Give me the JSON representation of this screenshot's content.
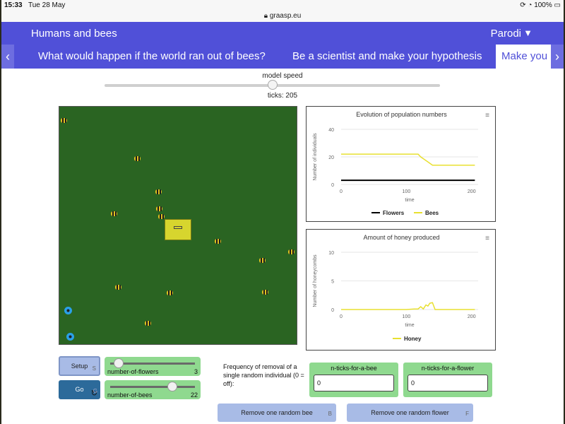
{
  "status": {
    "time": "15:33",
    "date": "Tue 28 May",
    "battery": "100%"
  },
  "browser": {
    "url": "graasp.eu"
  },
  "app": {
    "title": "Humans and bees",
    "user": "Parodi"
  },
  "tabs": [
    {
      "label": "What would happen if the world ran out of bees?"
    },
    {
      "label": "Be a scientist and make your hypothesis"
    },
    {
      "label": "Make you"
    }
  ],
  "model_speed": {
    "label": "model speed",
    "value": 0.5
  },
  "ticks_text": "ticks: 205",
  "controls": {
    "setup_label": "Setup",
    "setup_key": "S",
    "go_label": "Go",
    "go_key": "G",
    "flowers": {
      "label": "number-of-flowers",
      "value": "3",
      "fraction": 0.1
    },
    "bees": {
      "label": "number-of-bees",
      "value": "22",
      "fraction": 0.73
    },
    "frequency_text": "Frequency of removal of a single random individual (0 = off):",
    "n_ticks_bee": {
      "label": "n-ticks-for-a-bee",
      "value": "0"
    },
    "n_ticks_flower": {
      "label": "n-ticks-for-a-flower",
      "value": "0"
    },
    "remove_bee": {
      "label": "Remove one random bee",
      "key": "B"
    },
    "remove_flower": {
      "label": "Remove one random flower",
      "key": "F"
    }
  },
  "colors": {
    "flowers": "#000000",
    "bees": "#e8e030",
    "honey": "#e8e030",
    "world": "#2a6422"
  },
  "chart_data": [
    {
      "type": "line",
      "title": "Evolution of population numbers",
      "xlabel": "time",
      "ylabel": "Number of individuals",
      "xlim": [
        0,
        210
      ],
      "ylim": [
        0,
        40
      ],
      "x_ticks": [
        0,
        100,
        200
      ],
      "y_ticks": [
        0,
        20,
        40
      ],
      "legend_position": "bottom",
      "series": [
        {
          "name": "Flowers",
          "color": "#000000",
          "x": [
            0,
            205
          ],
          "y": [
            3,
            3
          ]
        },
        {
          "name": "Bees",
          "color": "#e8e030",
          "x": [
            0,
            118,
            122,
            128,
            134,
            140,
            205
          ],
          "y": [
            22,
            22,
            20,
            18,
            16,
            14,
            14
          ]
        }
      ]
    },
    {
      "type": "line",
      "title": "Amount of honey produced",
      "xlabel": "time",
      "ylabel": "Number of honeycombs",
      "xlim": [
        0,
        210
      ],
      "ylim": [
        0,
        10
      ],
      "x_ticks": [
        0,
        100,
        200
      ],
      "y_ticks": [
        0,
        5,
        10
      ],
      "legend_position": "bottom",
      "series": [
        {
          "name": "Honey",
          "color": "#e8e030",
          "x": [
            0,
            100,
            112,
            118,
            122,
            126,
            130,
            133,
            136,
            140,
            144,
            205
          ],
          "y": [
            0,
            0,
            0.1,
            0.1,
            0.5,
            0.1,
            0.8,
            0.6,
            1.1,
            1.2,
            0,
            0
          ]
        }
      ]
    }
  ]
}
